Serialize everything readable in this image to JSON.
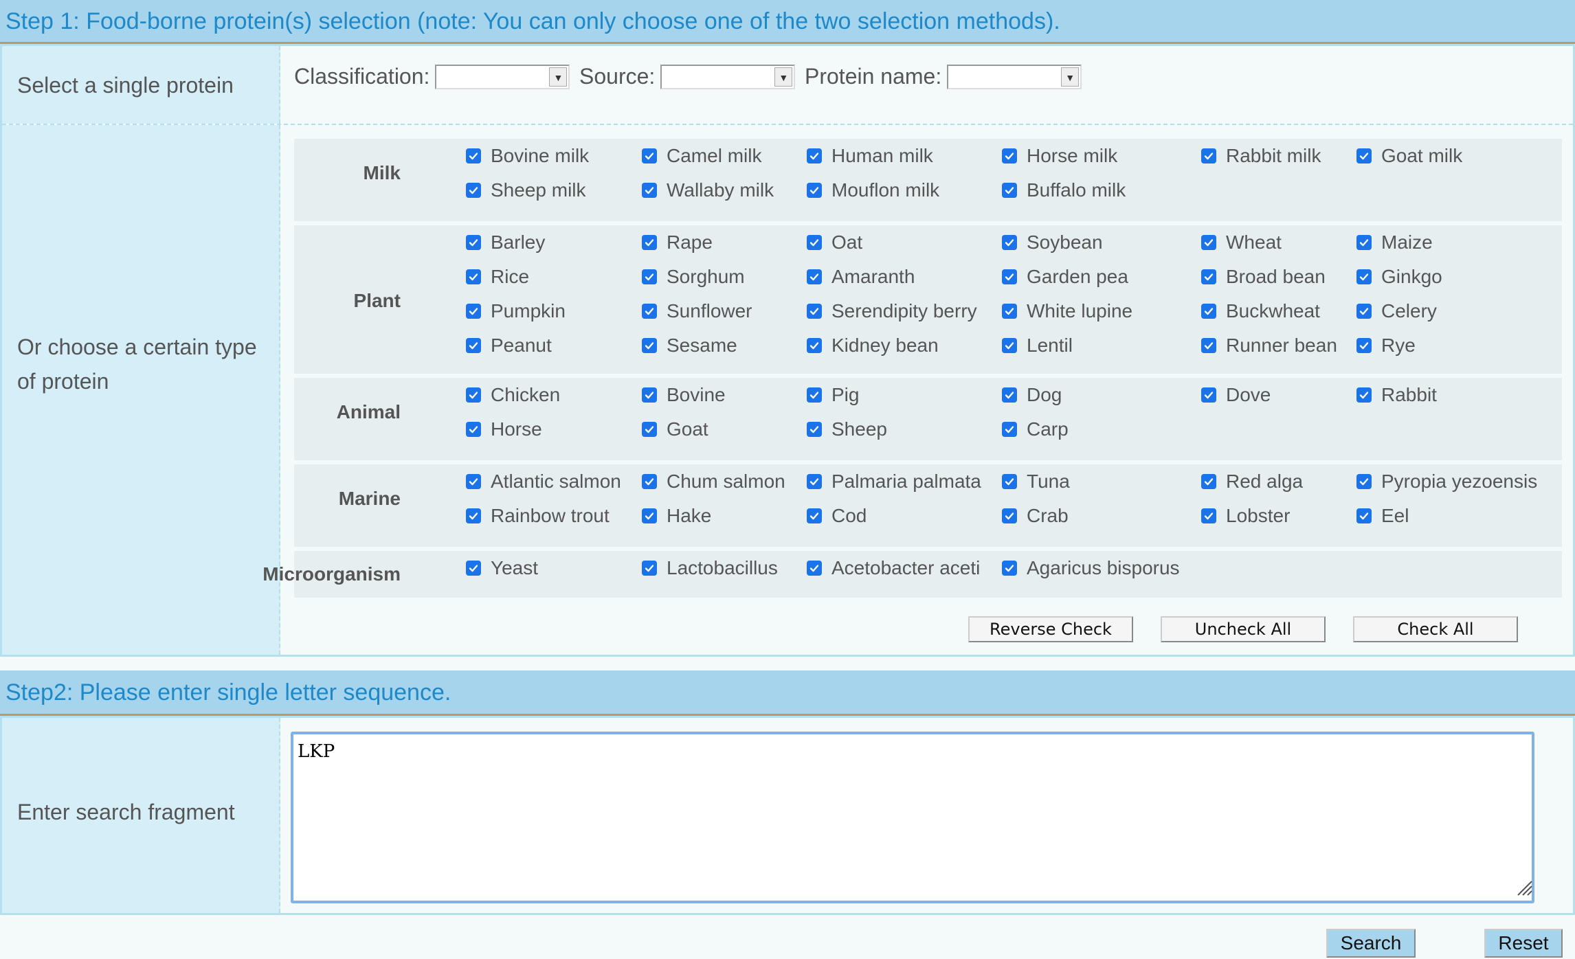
{
  "step1": {
    "title": "Step 1: Food-borne protein(s) selection (note: You can only choose one of the two selection methods).",
    "single_label": "Select a single protein",
    "type_label": "Or choose a certain type of protein",
    "selectors": {
      "classification_label": "Classification:",
      "source_label": "Source:",
      "protein_name_label": "Protein name:"
    },
    "categories": [
      {
        "name": "Milk",
        "items": [
          "Bovine milk",
          "Camel milk",
          "Human milk",
          "Horse milk",
          "Rabbit milk",
          "Goat milk",
          "Sheep milk",
          "Wallaby milk",
          "Mouflon milk",
          "Buffalo milk"
        ]
      },
      {
        "name": "Plant",
        "items": [
          "Barley",
          "Rape",
          "Oat",
          "Soybean",
          "Wheat",
          "Maize",
          "Rice",
          "Sorghum",
          "Amaranth",
          "Garden pea",
          "Broad bean",
          "Ginkgo",
          "Pumpkin",
          "Sunflower",
          "Serendipity berry",
          "White lupine",
          "Buckwheat",
          "Celery",
          "Peanut",
          "Sesame",
          "Kidney bean",
          "Lentil",
          "Runner bean",
          "Rye"
        ]
      },
      {
        "name": "Animal",
        "items": [
          "Chicken",
          "Bovine",
          "Pig",
          "Dog",
          "Dove",
          "Rabbit",
          "Horse",
          "Goat",
          "Sheep",
          "Carp"
        ]
      },
      {
        "name": "Marine",
        "items": [
          "Atlantic salmon",
          "Chum salmon",
          "Palmaria palmata",
          "Tuna",
          "Red alga",
          "Pyropia yezoensis",
          "Rainbow trout",
          "Hake",
          "Cod",
          "Crab",
          "Lobster",
          "Eel"
        ]
      },
      {
        "name": "Microorganism",
        "items": [
          "Yeast",
          "Lactobacillus",
          "Acetobacter aceti",
          "Agaricus bisporus"
        ]
      }
    ],
    "buttons": {
      "reverse": "Reverse Check",
      "uncheck": "Uncheck All",
      "check": "Check All"
    }
  },
  "step2": {
    "title": "Step2: Please enter single letter sequence.",
    "fragment_label": "Enter search fragment",
    "sequence_value": "LKP"
  },
  "actions": {
    "search": "Search",
    "reset": "Reset"
  },
  "colors": {
    "header_bg": "#a5d4ec",
    "header_text": "#1e88c8",
    "checkbox": "#1a73e8",
    "label_bg": "#d5eef8"
  }
}
